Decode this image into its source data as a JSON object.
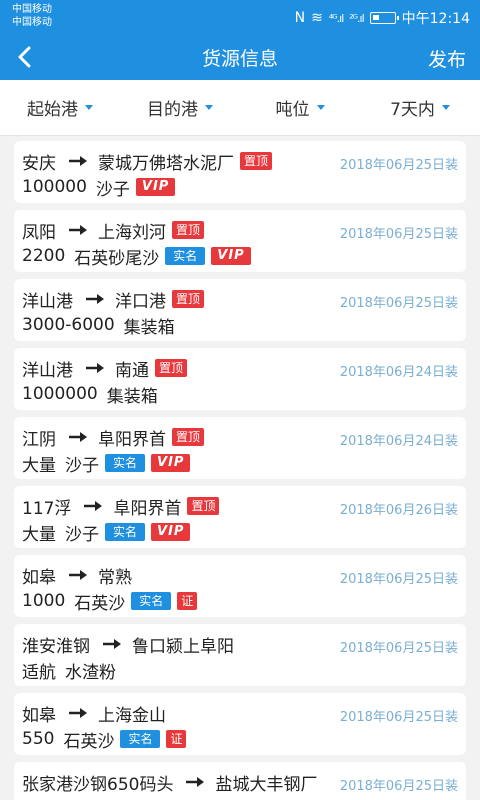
{
  "status_bar": {
    "carrier1": "中国移动",
    "carrier2": "中国移动",
    "nfc": "N",
    "wifi": "≋",
    "signal1": "⁴ᴳ.ıl",
    "signal2": "²ᴳ.ıl",
    "time": "中午12:14"
  },
  "nav": {
    "title": "货源信息",
    "action": "发布"
  },
  "filters": [
    "起始港",
    "目的港",
    "吨位",
    "7天内"
  ],
  "badges": {
    "top": "置顶",
    "real": "实名",
    "vip": "VIP",
    "cert": "证"
  },
  "items": [
    {
      "from": "安庆",
      "to": "蒙城万佛塔水泥厂",
      "qty": "100000",
      "cargo": "沙子",
      "date": "2018年06月25日装"
    },
    {
      "from": "凤阳",
      "to": "上海刘河",
      "qty": "2200",
      "cargo": "石英砂尾沙",
      "date": "2018年06月25日装"
    },
    {
      "from": "洋山港",
      "to": "洋口港",
      "qty": "3000-6000",
      "cargo": "集装箱",
      "date": "2018年06月25日装"
    },
    {
      "from": "洋山港",
      "to": "南通",
      "qty": "1000000",
      "cargo": "集装箱",
      "date": "2018年06月24日装"
    },
    {
      "from": "江阴",
      "to": "阜阳界首",
      "qty": "大量",
      "cargo": "沙子",
      "date": "2018年06月24日装"
    },
    {
      "from": "117浮",
      "to": "阜阳界首",
      "qty": "大量",
      "cargo": "沙子",
      "date": "2018年06月26日装"
    },
    {
      "from": "如皋",
      "to": "常熟",
      "qty": "1000",
      "cargo": "石英沙",
      "date": "2018年06月25日装"
    },
    {
      "from": "淮安淮钢",
      "to": "鲁口颍上阜阳",
      "qty": "适航",
      "cargo": "水渣粉",
      "date": "2018年06月25日装"
    },
    {
      "from": "如皋",
      "to": "上海金山",
      "qty": "550",
      "cargo": "石英沙",
      "date": "2018年06月25日装"
    },
    {
      "from": "张家港沙钢650码头",
      "to": "盐城大丰钢厂",
      "qty": "",
      "cargo": "",
      "date": "2018年06月25日装"
    }
  ]
}
